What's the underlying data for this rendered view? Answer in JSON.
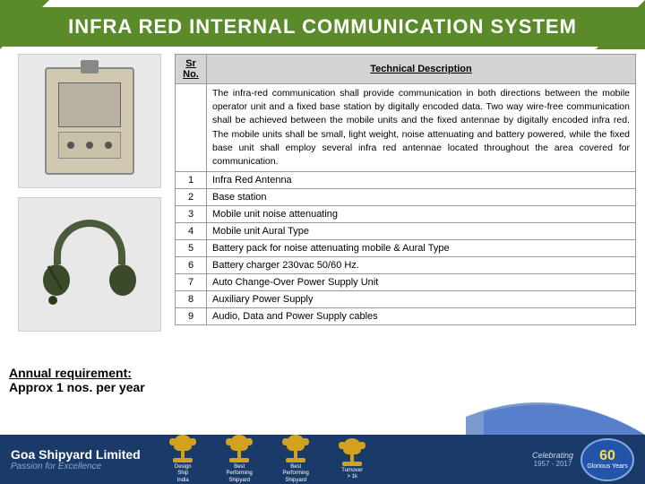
{
  "header": {
    "title": "INFRA RED  INTERNAL COMMUNICATION SYSTEM"
  },
  "intro": {
    "text": "The infra-red communication shall provide communication in both directions between the mobile operator unit and a fixed base station by digitally encoded data. Two way wire-free communication shall be achieved between the mobile units and the fixed antennae by digitally encoded infra red. The mobile units shall be small, light weight, noise attenuating and battery powered, while the fixed base unit shall employ several infra red antennae located throughout the area covered for communication."
  },
  "table": {
    "col_srno": "Sr No.",
    "col_desc": "Technical Description",
    "rows": [
      {
        "srno": "1",
        "desc": "Infra Red Antenna"
      },
      {
        "srno": "2",
        "desc": "Base station"
      },
      {
        "srno": "3",
        "desc": "Mobile unit noise attenuating"
      },
      {
        "srno": "4",
        "desc": "Mobile unit Aural Type"
      },
      {
        "srno": "5",
        "desc": "Battery pack for noise attenuating mobile & Aural Type"
      },
      {
        "srno": "6",
        "desc": "Battery charger 230vac 50/60 Hz."
      },
      {
        "srno": "7",
        "desc": "Auto Change-Over Power Supply Unit"
      },
      {
        "srno": "8",
        "desc": "Auxiliary Power Supply"
      },
      {
        "srno": "9",
        "desc": "Audio, Data and Power Supply cables"
      }
    ]
  },
  "annual_requirement": {
    "title": "Annual requirement:",
    "text": "Approx 1 nos. per year"
  },
  "footer": {
    "company_name": "Goa Shipyard Limited",
    "tagline": "Passion for Excellence",
    "celebration_text": "Celebrating",
    "years": "60",
    "years_label": "Glorious Years",
    "year_range": "1957 - 2017"
  },
  "trophies": [
    {
      "label": "Design\nShip\nIndia"
    },
    {
      "label": "Best\nPerforming\nShipyard"
    },
    {
      "label": "Best\nPerforming\nShipyard"
    },
    {
      "label": "Turnover\n> 1k"
    }
  ]
}
